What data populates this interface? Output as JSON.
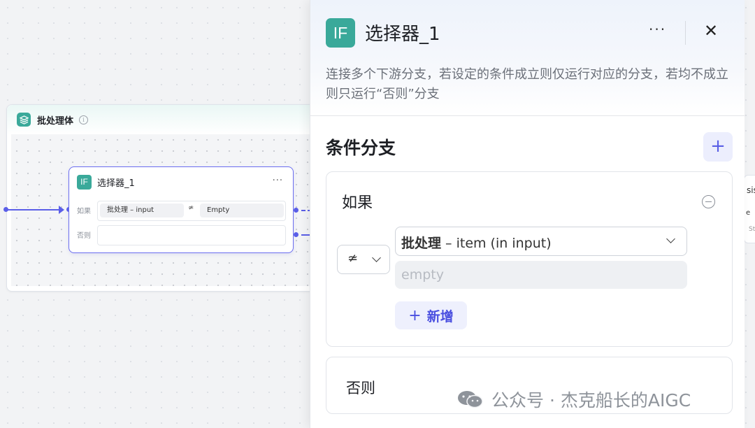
{
  "canvas": {
    "batch": {
      "title": "批处理体"
    },
    "node": {
      "title": "选择器_1",
      "icon_text": "IF",
      "more": "···",
      "if_label": "如果",
      "else_label": "否则",
      "condition": {
        "left": "批处理  –  input",
        "operator": "≄",
        "right": "Empty"
      }
    },
    "partial_node": {
      "line1": "sis",
      "line2": "e",
      "line3": "St"
    }
  },
  "panel": {
    "icon_text": "IF",
    "title": "选择器_1",
    "more": "···",
    "close": "✕",
    "description": "连接多个下游分支，若设定的条件成立则仅运行对应的分支，若均不成立则只运行“否则”分支",
    "section_title": "条件分支",
    "add_label": "+",
    "if_card": {
      "label": "如果",
      "operator_symbol": "≄",
      "variable_main": "批处理",
      "variable_rest": " – item (in input)",
      "value_placeholder": "empty",
      "new_plus": "+",
      "new_label": "新增"
    },
    "else_card": {
      "label": "否则"
    }
  },
  "watermark": {
    "text": "公众号 · 杰克船长的AIGC"
  },
  "colors": {
    "accent": "#5b5fe8",
    "if_icon": "#3aa99a"
  }
}
